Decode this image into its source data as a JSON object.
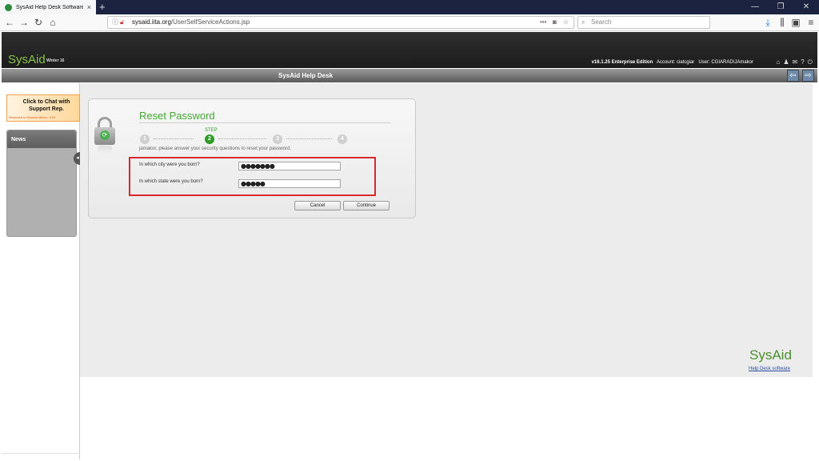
{
  "browser": {
    "tab_title": "SysAid Help Desk Software",
    "tab_close": "×",
    "new_tab": "+",
    "url_domain": "sysaid.iita.org",
    "url_path": "/UserSelfServiceActions.jsp",
    "search_placeholder": "Search",
    "back": "←",
    "forward": "→",
    "reload": "↻",
    "home": "⌂",
    "win_min": "—",
    "win_max": "❐",
    "win_close": "✕"
  },
  "header": {
    "logo": "SysAid",
    "logo_sub": "Winter 16",
    "version": "v16.1.25 Enterprise Edition",
    "account": "Account: ciatcgiar",
    "user": "User: CGIARAD\\JAmakor",
    "app_title": "SysAid Help Desk",
    "nav_back": "⇦",
    "nav_forward": "⇨"
  },
  "sidebar": {
    "chat_text": "Click to Chat with Support Rep.",
    "chat_sub": "Research to Nourish Africa · IITA",
    "news_label": "News",
    "collapse": "◂"
  },
  "reset": {
    "title": "Reset Password",
    "step_label": "STEP",
    "steps": [
      "1",
      "2",
      "3",
      "4"
    ],
    "current_step": 2,
    "instructions": "jamakor, please answer your security questions to reset your password.",
    "questions": [
      {
        "label": "In which city were you born?",
        "value": "●●●●●●●"
      },
      {
        "label": "In which state were you born?",
        "value": "●●●●●"
      }
    ],
    "cancel_label": "Cancel",
    "continue_label": "Continue"
  },
  "footer": {
    "logo": "SysAid",
    "link": "Help Desk software"
  },
  "colors": {
    "accent_green": "#44a733",
    "highlight_red": "#d9272e",
    "link_blue": "#2a4fa0"
  }
}
